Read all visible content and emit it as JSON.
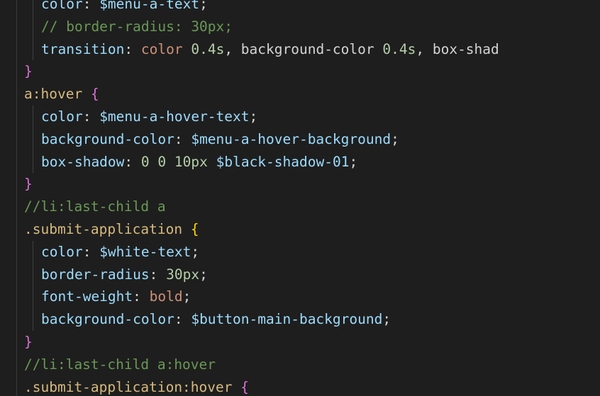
{
  "lines": [
    {
      "indent": 2,
      "tokens": [
        {
          "t": "prop",
          "v": "color"
        },
        {
          "t": "punc",
          "v": ": "
        },
        {
          "t": "var",
          "v": "$menu-a-text"
        },
        {
          "t": "punc",
          "v": ";"
        }
      ]
    },
    {
      "indent": 2,
      "tokens": [
        {
          "t": "comment",
          "v": "// border-radius: 30px;"
        }
      ]
    },
    {
      "indent": 2,
      "tokens": [
        {
          "t": "prop",
          "v": "transition"
        },
        {
          "t": "punc",
          "v": ": "
        },
        {
          "t": "kw",
          "v": "color"
        },
        {
          "t": "punc",
          "v": " "
        },
        {
          "t": "num",
          "v": "0.4s"
        },
        {
          "t": "punc",
          "v": ", "
        },
        {
          "t": "ident",
          "v": "background-color"
        },
        {
          "t": "punc",
          "v": " "
        },
        {
          "t": "num",
          "v": "0.4s"
        },
        {
          "t": "punc",
          "v": ", "
        },
        {
          "t": "ident",
          "v": "box-shad"
        }
      ]
    },
    {
      "indent": 1,
      "tokens": [
        {
          "t": "brace1",
          "v": "}"
        }
      ]
    },
    {
      "indent": 1,
      "tokens": [
        {
          "t": "sel",
          "v": "a:hover"
        },
        {
          "t": "punc",
          "v": " "
        },
        {
          "t": "brace1",
          "v": "{"
        }
      ]
    },
    {
      "indent": 2,
      "tokens": [
        {
          "t": "prop",
          "v": "color"
        },
        {
          "t": "punc",
          "v": ": "
        },
        {
          "t": "var",
          "v": "$menu-a-hover-text"
        },
        {
          "t": "punc",
          "v": ";"
        }
      ]
    },
    {
      "indent": 2,
      "tokens": [
        {
          "t": "prop",
          "v": "background-color"
        },
        {
          "t": "punc",
          "v": ": "
        },
        {
          "t": "var",
          "v": "$menu-a-hover-background"
        },
        {
          "t": "punc",
          "v": ";"
        }
      ]
    },
    {
      "indent": 2,
      "tokens": [
        {
          "t": "prop",
          "v": "box-shadow"
        },
        {
          "t": "punc",
          "v": ": "
        },
        {
          "t": "num",
          "v": "0"
        },
        {
          "t": "punc",
          "v": " "
        },
        {
          "t": "num",
          "v": "0"
        },
        {
          "t": "punc",
          "v": " "
        },
        {
          "t": "num",
          "v": "10px"
        },
        {
          "t": "punc",
          "v": " "
        },
        {
          "t": "var",
          "v": "$black-shadow-01"
        },
        {
          "t": "punc",
          "v": ";"
        }
      ]
    },
    {
      "indent": 1,
      "tokens": [
        {
          "t": "brace1",
          "v": "}"
        }
      ]
    },
    {
      "indent": 1,
      "tokens": [
        {
          "t": "comment",
          "v": "//li:last-child a"
        }
      ]
    },
    {
      "indent": 1,
      "tokens": [
        {
          "t": "sel",
          "v": ".submit-application"
        },
        {
          "t": "punc",
          "v": " "
        },
        {
          "t": "brace2",
          "v": "{"
        }
      ]
    },
    {
      "indent": 2,
      "tokens": [
        {
          "t": "prop",
          "v": "color"
        },
        {
          "t": "punc",
          "v": ": "
        },
        {
          "t": "var",
          "v": "$white-text"
        },
        {
          "t": "punc",
          "v": ";"
        }
      ]
    },
    {
      "indent": 2,
      "tokens": [
        {
          "t": "prop",
          "v": "border-radius"
        },
        {
          "t": "punc",
          "v": ": "
        },
        {
          "t": "num",
          "v": "30px"
        },
        {
          "t": "punc",
          "v": ";"
        }
      ]
    },
    {
      "indent": 2,
      "tokens": [
        {
          "t": "prop",
          "v": "font-weight"
        },
        {
          "t": "punc",
          "v": ": "
        },
        {
          "t": "kw",
          "v": "bold"
        },
        {
          "t": "punc",
          "v": ";"
        }
      ]
    },
    {
      "indent": 2,
      "tokens": [
        {
          "t": "prop",
          "v": "background-color"
        },
        {
          "t": "punc",
          "v": ": "
        },
        {
          "t": "var",
          "v": "$button-main-background"
        },
        {
          "t": "punc",
          "v": ";"
        }
      ]
    },
    {
      "indent": 1,
      "tokens": [
        {
          "t": "brace1",
          "v": "}"
        }
      ]
    },
    {
      "indent": 1,
      "tokens": [
        {
          "t": "comment",
          "v": "//li:last-child a:hover"
        }
      ]
    },
    {
      "indent": 1,
      "tokens": [
        {
          "t": "sel",
          "v": ".submit-application:hover"
        },
        {
          "t": "punc",
          "v": " "
        },
        {
          "t": "brace1",
          "v": "{"
        }
      ]
    }
  ],
  "colors": {
    "background": "#1e1e1e",
    "property": "#9cdcfe",
    "comment": "#6a9955",
    "number": "#b5cea8",
    "keyword": "#ce9178",
    "selector": "#d7ba7d",
    "brace_magenta": "#da70d6",
    "brace_gold": "#ffd700"
  }
}
